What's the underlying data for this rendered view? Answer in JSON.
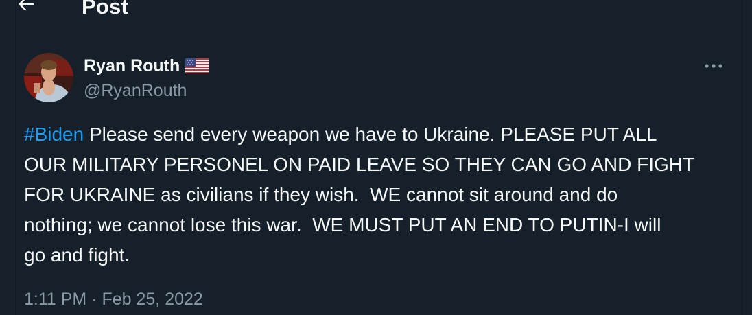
{
  "header": {
    "title": "Post",
    "back_icon": "arrow-left-icon"
  },
  "author": {
    "display_name": "Ryan Routh",
    "handle": "@RyanRouth",
    "badge_icon": "us-flag-icon",
    "avatar_icon": "avatar-photo"
  },
  "post": {
    "hashtag": "#Biden",
    "lines": [
      " Please send every weapon we have to Ukraine. PLEASE PUT ALL",
      "OUR MILITARY PERSONEL ON PAID LEAVE SO THEY CAN GO AND FIGHT",
      "FOR UKRAINE as civilians if they wish.  WE cannot sit around and do",
      "nothing; we cannot lose this war.  WE MUST PUT AN END TO PUTIN-I will",
      "go and fight."
    ],
    "time": "1:11 PM",
    "separator": " · ",
    "date": "Feb 25, 2022"
  },
  "more_icon": "more-horizontal-icon",
  "colors": {
    "background": "#15202b",
    "text": "#f7f9f9",
    "secondary_text": "#8b98a5",
    "link": "#1d9bf0",
    "border": "#38444d"
  }
}
